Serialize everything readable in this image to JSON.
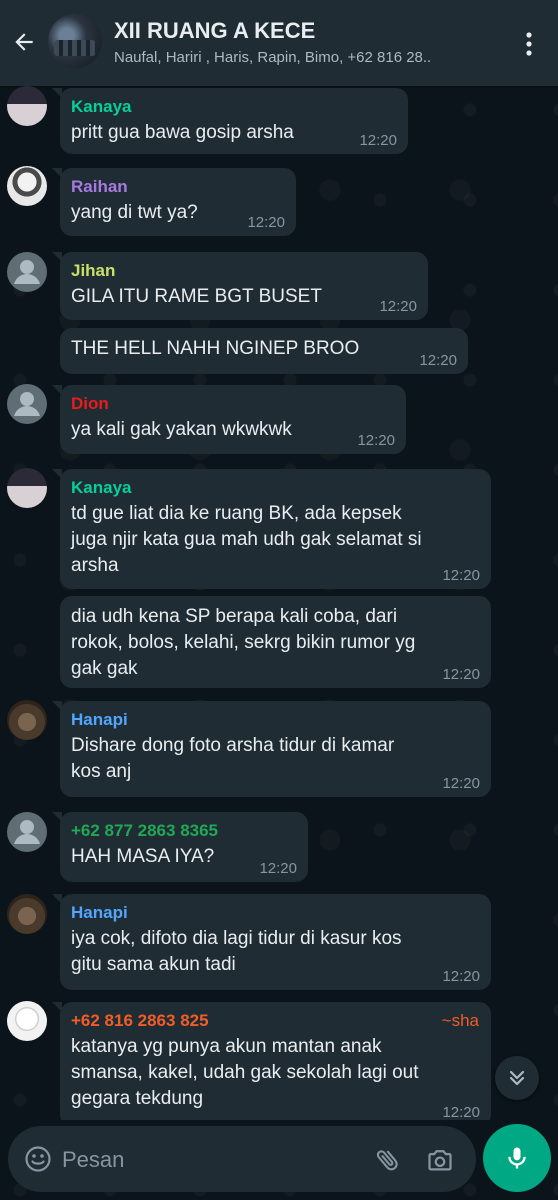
{
  "header": {
    "title": "XII RUANG A KECE",
    "subtitle": "Naufal, Hariri , Haris, Rapin, Bimo, +62 816 28.."
  },
  "messages": [
    {
      "sender": "Kanaya",
      "sender_color": "#06cf9c",
      "text": "pritt gua bawa gosip arsha",
      "time": "12:20"
    },
    {
      "sender": "Raihan",
      "sender_color": "#a67be0",
      "text": "yang di twt ya?",
      "time": "12:20"
    },
    {
      "sender": "Jihan",
      "sender_color": "#c8e06a",
      "text": "GILA ITU RAME BGT BUSET",
      "time": "12:20"
    },
    {
      "sender": "",
      "sender_color": "",
      "text": "THE HELL NAHH NGINEP BROO",
      "time": "12:20"
    },
    {
      "sender": "Dion",
      "sender_color": "#e81c1c",
      "text": "ya kali gak yakan wkwkwk",
      "time": "12:20"
    },
    {
      "sender": "Kanaya",
      "sender_color": "#06cf9c",
      "text": "td gue liat dia ke ruang BK, ada kepsek\njuga njir kata gua mah udh gak selamat si\narsha",
      "time": "12:20"
    },
    {
      "sender": "",
      "sender_color": "",
      "text": "dia udh kena SP berapa kali coba, dari\nrokok, bolos, kelahi, sekrg bikin rumor yg\ngak gak",
      "time": "12:20"
    },
    {
      "sender": "Hanapi",
      "sender_color": "#53a6fd",
      "text": "Dishare dong foto arsha tidur di kamar\nkos anj",
      "time": "12:20"
    },
    {
      "sender": "+62 877 2863 8365",
      "sender_color": "#1fa855",
      "text": "HAH MASA IYA?",
      "time": "12:20"
    },
    {
      "sender": "Hanapi",
      "sender_color": "#53a6fd",
      "text": "iya cok, difoto dia lagi tidur di kasur kos\ngitu sama akun tadi",
      "time": "12:20"
    },
    {
      "sender": "+62 816 2863 825",
      "sender_color": "#f15c27",
      "pushname": "~sha",
      "text": "katanya yg punya akun mantan anak\nsmansa, kakel, udah gak sekolah lagi out\ngegara tekdung",
      "time": "12:20"
    }
  ],
  "composer": {
    "placeholder": "Pesan"
  },
  "icons": {
    "back": "arrow-left-icon",
    "menu": "more-vertical-icon",
    "emoji": "emoji-icon",
    "attach": "paperclip-icon",
    "camera": "camera-icon",
    "mic": "microphone-icon",
    "scroll": "double-chevron-down-icon"
  },
  "colors": {
    "background": "#0b141a",
    "header": "#1f2c33",
    "bubble": "#202c33",
    "accent": "#00a884",
    "timestamp": "#8696a0"
  }
}
